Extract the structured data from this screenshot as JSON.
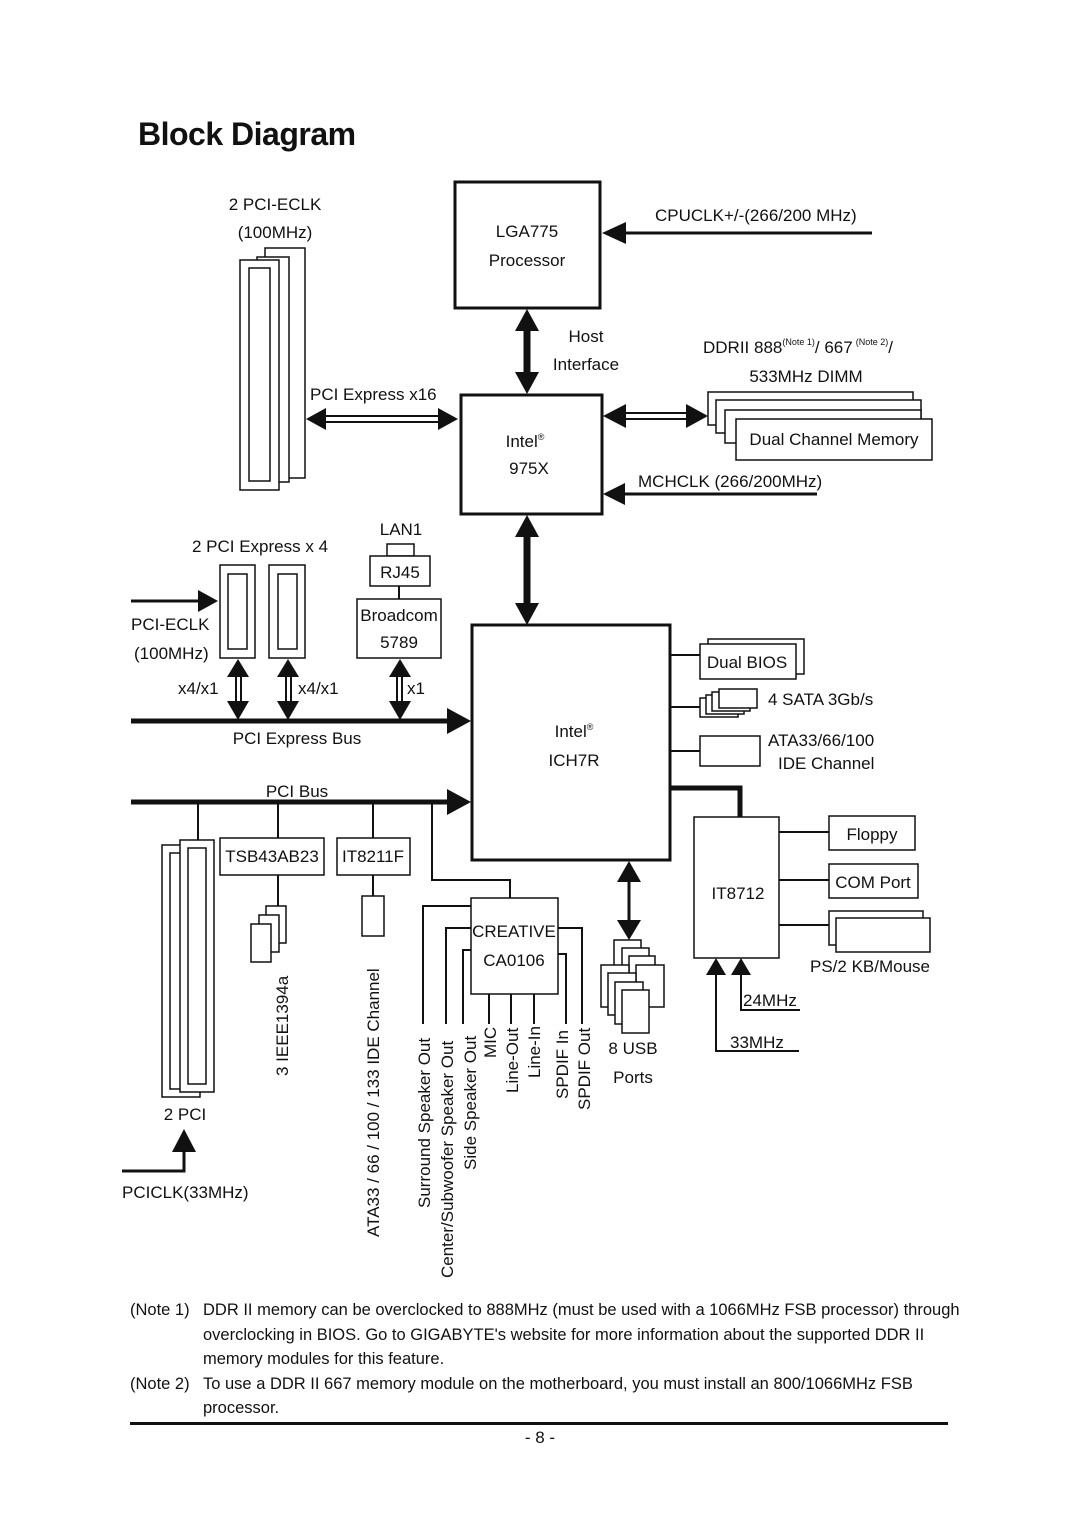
{
  "title": "Block Diagram",
  "colors": {
    "ink": "#111111",
    "paper": "#ffffff"
  },
  "blocks": {
    "cpu": {
      "line1": "LGA775",
      "line2": "Processor"
    },
    "northbridge": {
      "line1": "Intel",
      "reg": "®",
      "line2": "975X"
    },
    "southbridge": {
      "line1": "Intel",
      "reg": "®",
      "line2": "ICH7R"
    },
    "lan_chip": {
      "line1": "Broadcom",
      "line2": "5789"
    },
    "rj45": "RJ45",
    "ieee_chip": "TSB43AB23",
    "ide_chip": "IT8211F",
    "audio_chip": {
      "line1": "CREATIVE",
      "line2": "CA0106"
    },
    "superio": "IT8712",
    "dual_bios": "Dual BIOS",
    "floppy": "Floppy",
    "com_port": "COM Port",
    "dual_channel_memory": "Dual Channel Memory"
  },
  "labels": {
    "pcie_eclk_top_1": "2 PCI-ECLK",
    "pcie_eclk_top_2": "(100MHz)",
    "cpuclk": "CPUCLK+/-(266/200 MHz)",
    "host_1": "Host",
    "host_2": "Interface",
    "pcie_x16": "PCI Express x16",
    "ddr_prefix": "DDRII 888",
    "ddr_note1": "(Note 1)",
    "ddr_mid": "/ 667",
    "ddr_note2": "(Note 2)",
    "ddr_suffix": "/",
    "ddr_line2": "533MHz DIMM",
    "mchclk": "MCHCLK (266/200MHz)",
    "pcie_x4": "2 PCI Express x 4",
    "lan1": "LAN1",
    "pcie_eclk_left_1": "PCI-ECLK",
    "pcie_eclk_left_2": "(100MHz)",
    "link_x4x1_a": "x4/x1",
    "link_x4x1_b": "x4/x1",
    "link_x1": "x1",
    "pcie_bus": "PCI Express Bus",
    "pci_bus": "PCI Bus",
    "sata": "4 SATA 3Gb/s",
    "ata_1": "ATA33/66/100",
    "ata_2": "IDE Channel",
    "ieee1394": "3 IEEE1394a",
    "ata133": "ATA33 / 66 / 100 / 133 IDE Channel",
    "pci_slots": "2 PCI",
    "pciclk": "PCICLK(33MHz)",
    "usb_1": "8 USB",
    "usb_2": "Ports",
    "ps2": "PS/2 KB/Mouse",
    "clk24": "24MHz",
    "clk33": "33MHz"
  },
  "audio_outputs": [
    "Surround Speaker Out",
    "Center/Subwoofer Speaker Out",
    "Side Speaker Out",
    "MIC",
    "Line-Out",
    "Line-In",
    "SPDIF In",
    "SPDIF Out"
  ],
  "notes": [
    {
      "tag": "(Note 1)",
      "text": "DDR II memory can be overclocked to 888MHz (must be used with a 1066MHz FSB processor) through overclocking in BIOS. Go to GIGABYTE's website for more information about the supported DDR II memory modules for this feature."
    },
    {
      "tag": "(Note 2)",
      "text": "To use a DDR II 667 memory module on the motherboard, you must install an 800/1066MHz FSB processor."
    }
  ],
  "page_number": "- 8 -"
}
